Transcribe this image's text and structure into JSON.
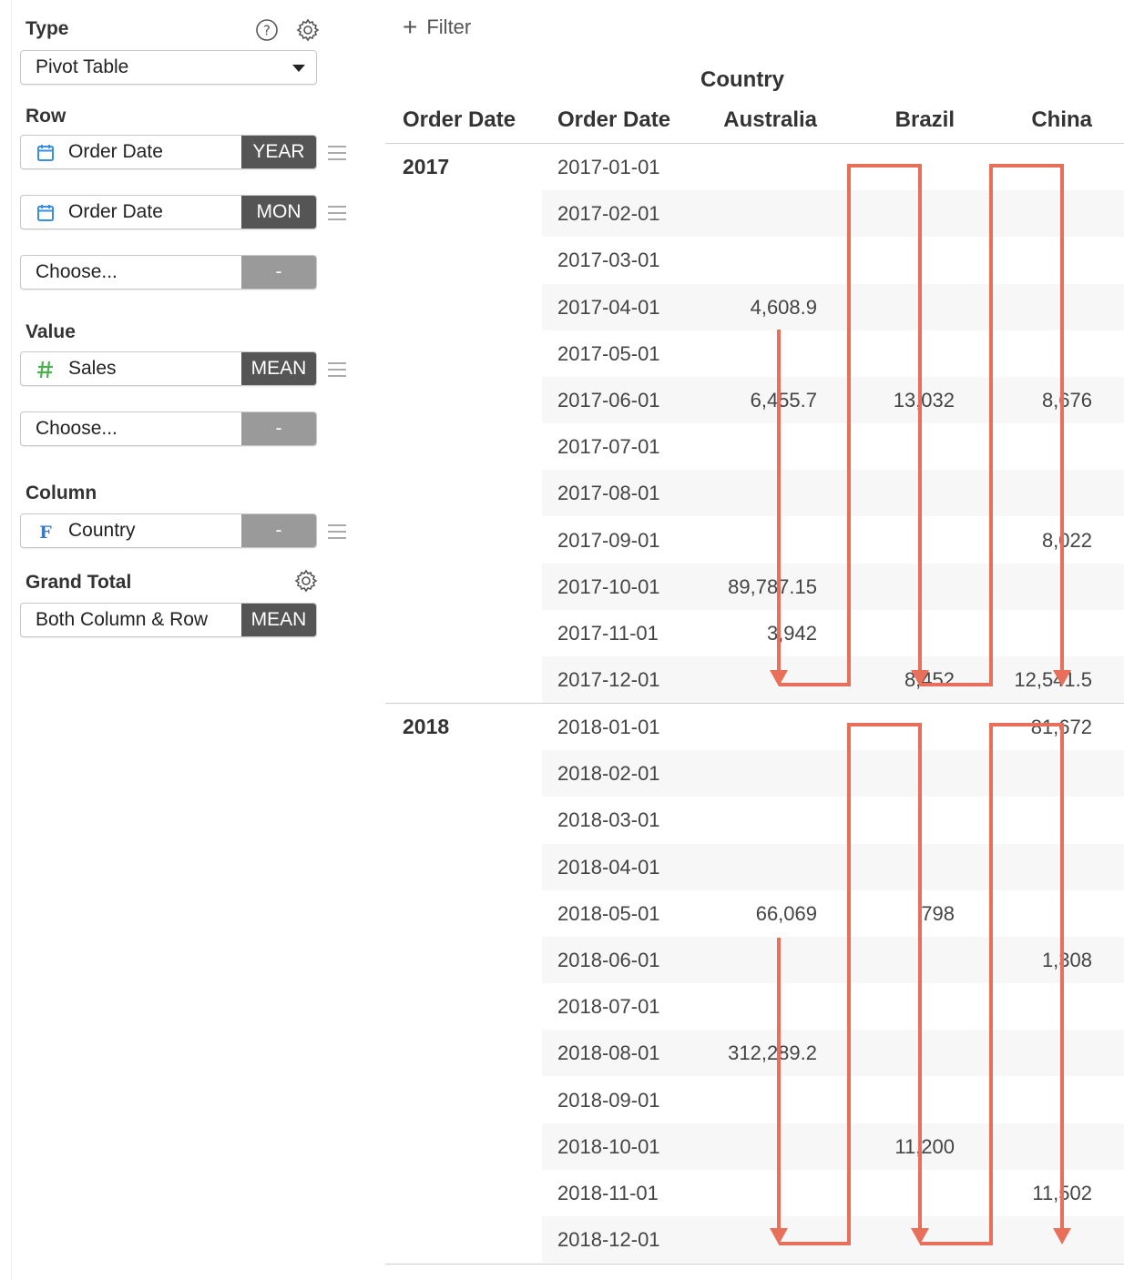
{
  "panel": {
    "type": {
      "label": "Type",
      "selected": "Pivot Table"
    },
    "row": {
      "label": "Row",
      "fields": [
        {
          "name": "Order Date",
          "icon": "calendar-icon",
          "tag": "YEAR"
        },
        {
          "name": "Order Date",
          "icon": "calendar-icon",
          "tag": "MON"
        },
        {
          "name": "Choose...",
          "tag": "-"
        }
      ]
    },
    "value": {
      "label": "Value",
      "fields": [
        {
          "name": "Sales",
          "icon": "hash-icon",
          "tag": "MEAN"
        },
        {
          "name": "Choose...",
          "tag": "-"
        }
      ]
    },
    "column": {
      "label": "Column",
      "fields": [
        {
          "name": "Country",
          "icon": "factor-icon",
          "tag": "-"
        }
      ]
    },
    "grand_total": {
      "label": "Grand Total",
      "value": "Both Column & Row",
      "tag": "MEAN"
    }
  },
  "filter_label": "Filter",
  "table": {
    "column_group": "Country",
    "headers": [
      "Order Date",
      "Order Date",
      "Australia",
      "Brazil",
      "China"
    ],
    "groups": [
      {
        "year": "2017",
        "rows": [
          {
            "date": "2017-01-01",
            "australia": "",
            "brazil": "",
            "china": ""
          },
          {
            "date": "2017-02-01",
            "australia": "",
            "brazil": "",
            "china": ""
          },
          {
            "date": "2017-03-01",
            "australia": "",
            "brazil": "",
            "china": ""
          },
          {
            "date": "2017-04-01",
            "australia": "4,608.9",
            "brazil": "",
            "china": ""
          },
          {
            "date": "2017-05-01",
            "australia": "",
            "brazil": "",
            "china": ""
          },
          {
            "date": "2017-06-01",
            "australia": "6,455.7",
            "brazil": "13,032",
            "china": "8,676"
          },
          {
            "date": "2017-07-01",
            "australia": "",
            "brazil": "",
            "china": ""
          },
          {
            "date": "2017-08-01",
            "australia": "",
            "brazil": "",
            "china": ""
          },
          {
            "date": "2017-09-01",
            "australia": "",
            "brazil": "",
            "china": "8,022"
          },
          {
            "date": "2017-10-01",
            "australia": "89,787.15",
            "brazil": "",
            "china": ""
          },
          {
            "date": "2017-11-01",
            "australia": "3,942",
            "brazil": "",
            "china": ""
          },
          {
            "date": "2017-12-01",
            "australia": "",
            "brazil": "8,452",
            "china": "12,541.5"
          }
        ]
      },
      {
        "year": "2018",
        "rows": [
          {
            "date": "2018-01-01",
            "australia": "",
            "brazil": "",
            "china": "81,672"
          },
          {
            "date": "2018-02-01",
            "australia": "",
            "brazil": "",
            "china": ""
          },
          {
            "date": "2018-03-01",
            "australia": "",
            "brazil": "",
            "china": ""
          },
          {
            "date": "2018-04-01",
            "australia": "",
            "brazil": "",
            "china": ""
          },
          {
            "date": "2018-05-01",
            "australia": "66,069",
            "brazil": "798",
            "china": ""
          },
          {
            "date": "2018-06-01",
            "australia": "",
            "brazil": "",
            "china": "1,308"
          },
          {
            "date": "2018-07-01",
            "australia": "",
            "brazil": "",
            "china": ""
          },
          {
            "date": "2018-08-01",
            "australia": "312,289.2",
            "brazil": "",
            "china": ""
          },
          {
            "date": "2018-09-01",
            "australia": "",
            "brazil": "",
            "china": ""
          },
          {
            "date": "2018-10-01",
            "australia": "",
            "brazil": "11,200",
            "china": ""
          },
          {
            "date": "2018-11-01",
            "australia": "",
            "brazil": "",
            "china": "11,502"
          },
          {
            "date": "2018-12-01",
            "australia": "",
            "brazil": "",
            "china": ""
          }
        ]
      }
    ]
  },
  "colors": {
    "arrow": "#e8705a",
    "tag_dark": "#555555",
    "tag_light": "#9a9a9a",
    "calendar": "#3a8ee6",
    "hash": "#4caf50",
    "factor": "#3a78c8"
  }
}
